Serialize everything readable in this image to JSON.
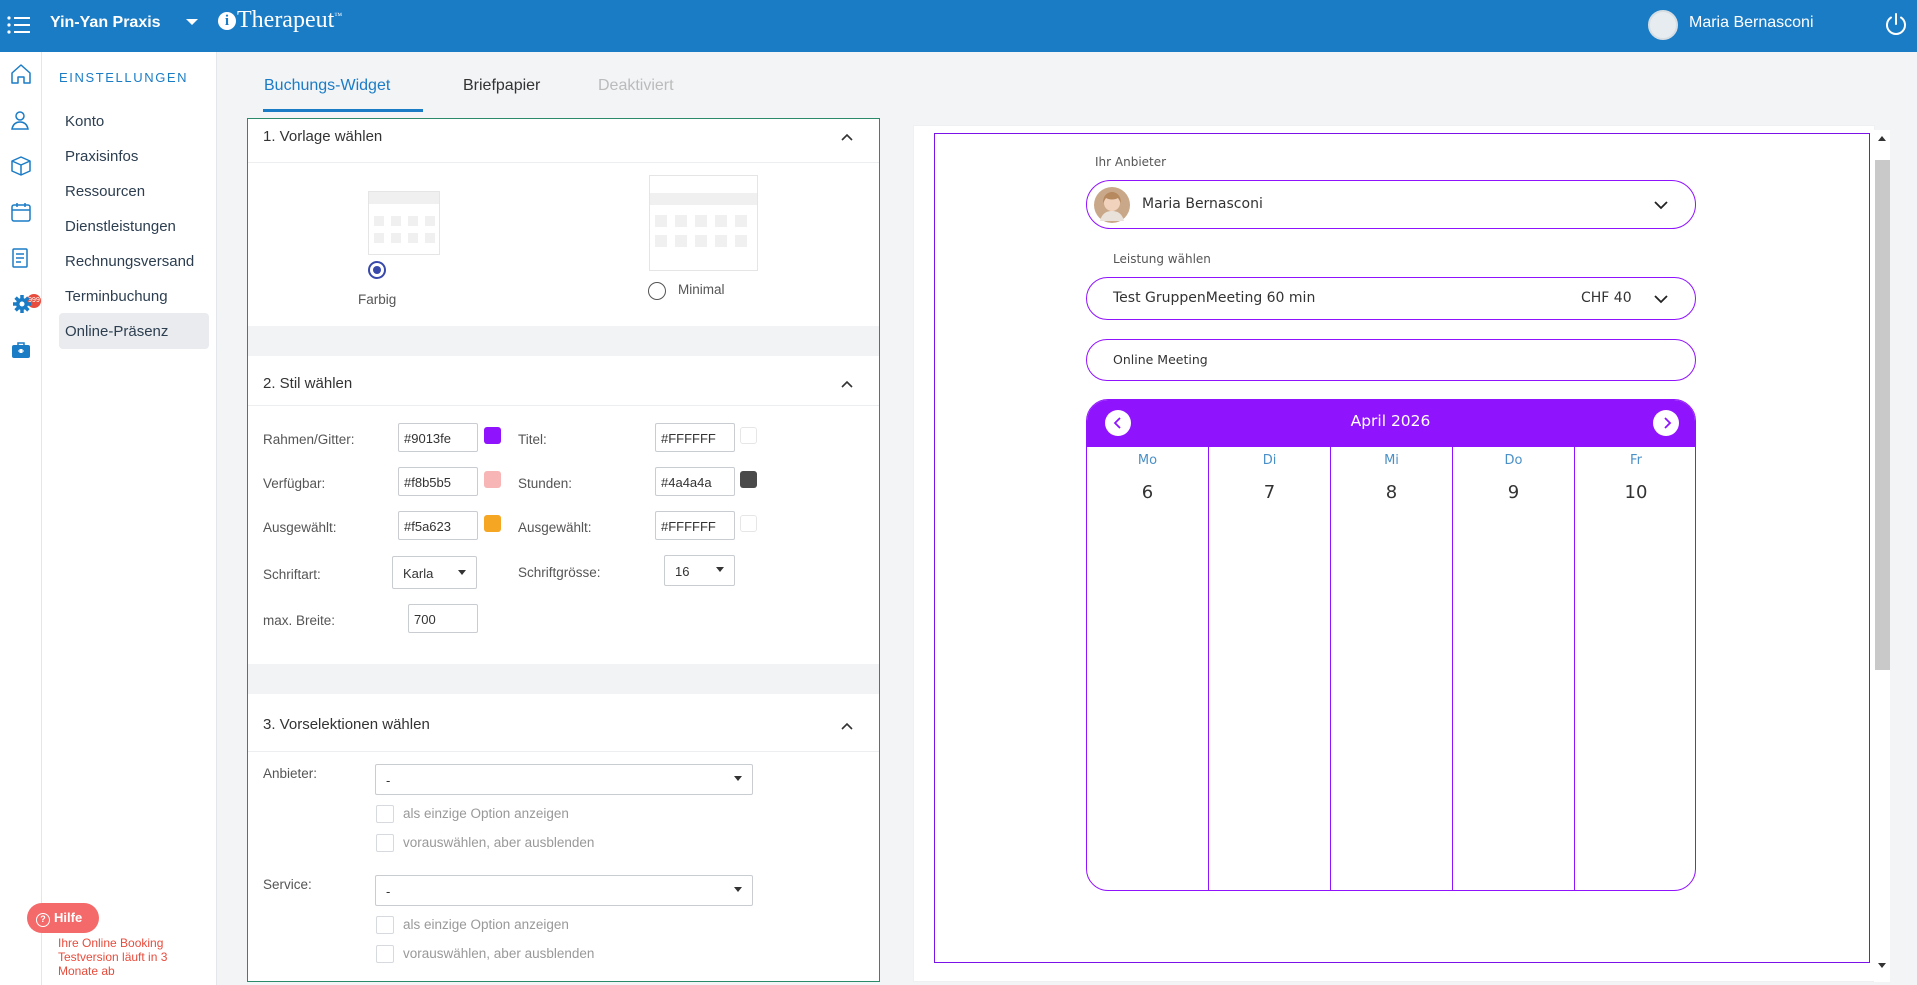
{
  "topbar": {
    "practice": "Yin-Yan Praxis",
    "logo": "Therapeut",
    "logo_tm": "™",
    "user": "Maria Bernasconi",
    "icons": [
      "menu-icon",
      "caret-down-icon",
      "avatar",
      "power-icon"
    ]
  },
  "iconbar": {
    "icons": [
      "home-icon",
      "users-icon",
      "box-icon",
      "calendar-icon",
      "invoice-icon",
      "gear-icon",
      "briefcase-icon"
    ],
    "badge": "999"
  },
  "settings": {
    "header": "EINSTELLUNGEN",
    "items": [
      "Konto",
      "Praxisinfos",
      "Ressourcen",
      "Dienstleistungen",
      "Rechnungsversand",
      "Terminbuchung",
      "Online-Präsenz"
    ],
    "active_index": 6
  },
  "help": {
    "label": "Hilfe",
    "trial": "Ihre Online Booking Testversion läuft in 3 Monate ab"
  },
  "tabs": [
    {
      "label": "Buchungs-Widget",
      "state": "active"
    },
    {
      "label": "Briefpapier",
      "state": "normal"
    },
    {
      "label": "Deaktiviert",
      "state": "disabled"
    }
  ],
  "section1": {
    "title": "1. Vorlage wählen",
    "options": [
      {
        "label": "Farbig",
        "selected": true
      },
      {
        "label": "Minimal",
        "selected": false
      }
    ]
  },
  "section2": {
    "title": "2. Stil wählen",
    "fields": {
      "rahmen": {
        "label": "Rahmen/Gitter:",
        "value": "#9013fe",
        "color": "#9013fe"
      },
      "titel": {
        "label": "Titel:",
        "value": "#FFFFFF",
        "color": "#FFFFFF"
      },
      "verfuegbar": {
        "label": "Verfügbar:",
        "value": "#f8b5b5",
        "color": "#f8b5b5"
      },
      "stunden": {
        "label": "Stunden:",
        "value": "#4a4a4a",
        "color": "#4a4a4a"
      },
      "ausgewaehlt1": {
        "label": "Ausgewählt:",
        "value": "#f5a623",
        "color": "#f5a623"
      },
      "ausgewaehlt2": {
        "label": "Ausgewählt:",
        "value": "#FFFFFF",
        "color": "#FFFFFF"
      },
      "schriftart": {
        "label": "Schriftart:",
        "value": "Karla"
      },
      "schriftgroesse": {
        "label": "Schriftgrösse:",
        "value": "16"
      },
      "breite": {
        "label": "max. Breite:",
        "value": "700"
      }
    }
  },
  "section3": {
    "title": "3. Vorselektionen wählen",
    "anbieter": {
      "label": "Anbieter:",
      "value": "-"
    },
    "service": {
      "label": "Service:",
      "value": "-"
    },
    "opt_only": "als einzige Option anzeigen",
    "opt_hide": "vorauswählen, aber ausblenden"
  },
  "widget": {
    "provider_label": "Ihr Anbieter",
    "provider": "Maria Bernasconi",
    "service_label": "Leistung wählen",
    "service": "Test GruppenMeeting 60 min",
    "price": "CHF 40",
    "location": "Online Meeting",
    "month": "April 2026",
    "days": [
      {
        "name": "Mo",
        "date": "6"
      },
      {
        "name": "Di",
        "date": "7"
      },
      {
        "name": "Mi",
        "date": "8"
      },
      {
        "name": "Do",
        "date": "9"
      },
      {
        "name": "Fr",
        "date": "10"
      }
    ],
    "accent": "#9013fe"
  }
}
